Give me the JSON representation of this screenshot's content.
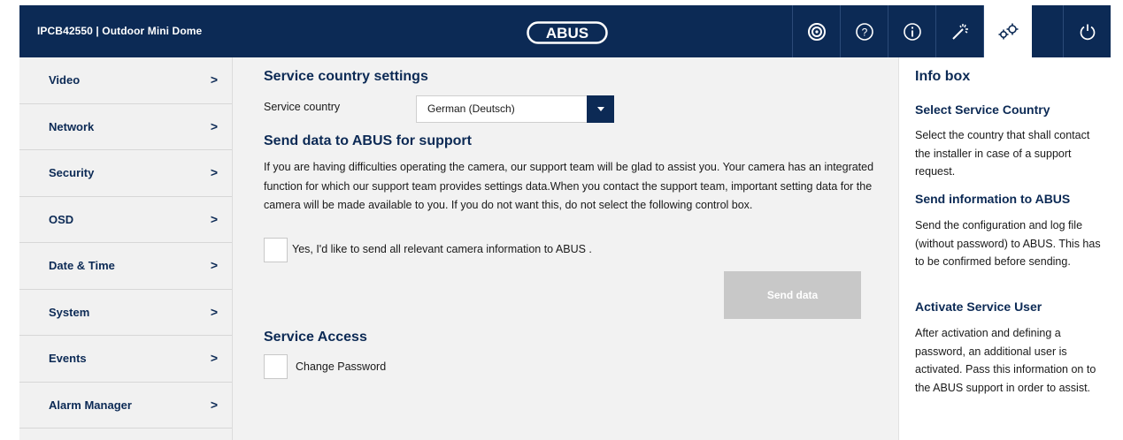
{
  "header": {
    "device_title": "IPCB42550 | Outdoor Mini Dome",
    "logo_text": "ABUS",
    "icons": [
      "live-view-icon",
      "help-icon",
      "info-icon",
      "wizard-icon",
      "settings-icon",
      "power-icon"
    ]
  },
  "nav": {
    "items": [
      {
        "label": "Video",
        "chevron": ">"
      },
      {
        "label": "Network",
        "chevron": ">"
      },
      {
        "label": "Security",
        "chevron": ">"
      },
      {
        "label": "OSD",
        "chevron": ">"
      },
      {
        "label": "Date & Time",
        "chevron": ">"
      },
      {
        "label": "System",
        "chevron": ">"
      },
      {
        "label": "Events",
        "chevron": ">"
      },
      {
        "label": "Alarm Manager",
        "chevron": ">"
      }
    ]
  },
  "main": {
    "service_country_heading": "Service country settings",
    "service_country_label": "Service country",
    "service_country_value": "German (Deutsch)",
    "send_data_heading": "Send data to ABUS for support",
    "send_data_paragraph": "If you are having difficulties operating the camera, our support team will be glad to assist you. Your camera has an integrated function for which our support team provides settings data.When you contact the support team, important setting data for the camera will be made available to you. If you do not want this, do not select the following control box.",
    "send_checkbox_label": "Yes, I'd like to send all relevant camera information to ABUS .",
    "send_button": "Send data",
    "service_access_heading": "Service Access",
    "change_password_label": "Change Password"
  },
  "info": {
    "title": "Info box",
    "sections": [
      {
        "heading": "Select Service Country",
        "text": "Select the country that shall contact the installer in case of a support request."
      },
      {
        "heading": "Send information to ABUS",
        "text": "Send the configuration and log file (without password) to ABUS. This has to be confirmed before sending."
      },
      {
        "heading": "Activate Service User",
        "text": "After activation and defining a password, an additional user is activated. Pass this information on to the ABUS support in order to assist."
      }
    ]
  },
  "colors": {
    "header_bg": "#0c2a55",
    "accent": "#0c2a55",
    "disabled_button": "#c8c8c8",
    "panel_bg": "#f2f2f2"
  }
}
